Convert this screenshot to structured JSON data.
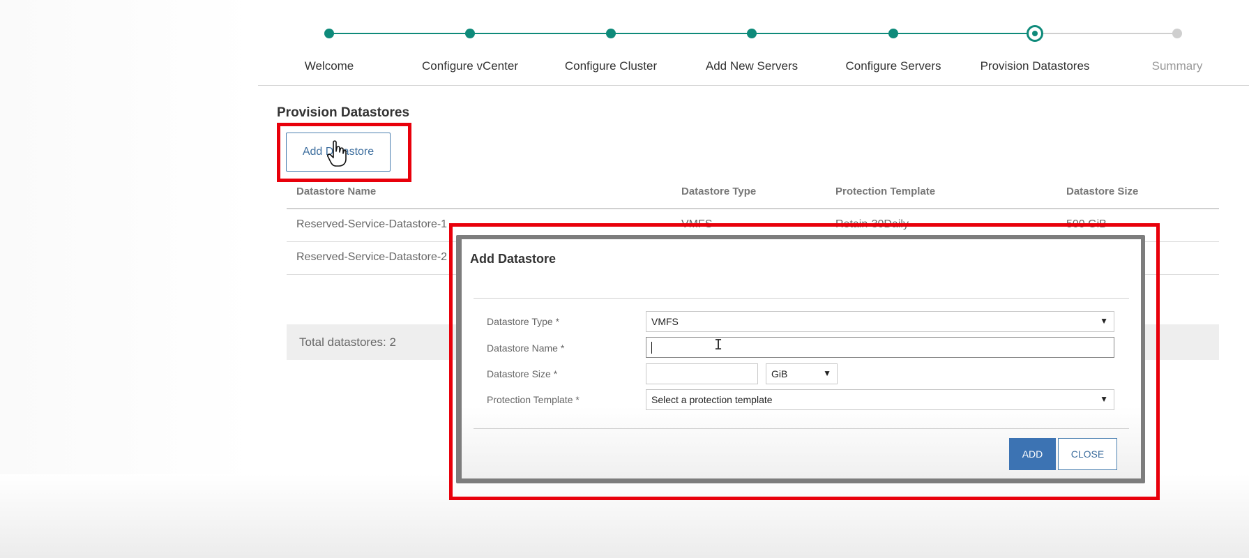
{
  "wizard": {
    "steps": [
      {
        "label": "Welcome",
        "state": "done"
      },
      {
        "label": "Configure vCenter",
        "state": "done"
      },
      {
        "label": "Configure Cluster",
        "state": "done"
      },
      {
        "label": "Add New Servers",
        "state": "done"
      },
      {
        "label": "Configure Servers",
        "state": "done"
      },
      {
        "label": "Provision Datastores",
        "state": "current"
      },
      {
        "label": "Summary",
        "state": "todo"
      }
    ],
    "accent_color": "#0e8a7a"
  },
  "page": {
    "title": "Provision Datastores",
    "add_button_label": "Add Datastore"
  },
  "table": {
    "columns": [
      "Datastore Name",
      "Datastore Type",
      "Protection Template",
      "Datastore Size"
    ],
    "rows": [
      [
        "Reserved-Service-Datastore-1",
        "VMFS",
        "Retain-30Daily",
        "500 GiB"
      ],
      [
        "Reserved-Service-Datastore-2",
        "",
        "",
        ""
      ]
    ],
    "footer": "Total datastores: 2"
  },
  "modal": {
    "title": "Add Datastore",
    "fields": {
      "type_label": "Datastore Type *",
      "type_value": "VMFS",
      "name_label": "Datastore Name *",
      "name_value": "",
      "size_label": "Datastore Size *",
      "size_value": "",
      "size_unit": "GiB",
      "template_label": "Protection Template *",
      "template_placeholder": "Select a protection template"
    },
    "add_label": "ADD",
    "close_label": "CLOSE"
  },
  "highlight_color": "#e8000b"
}
